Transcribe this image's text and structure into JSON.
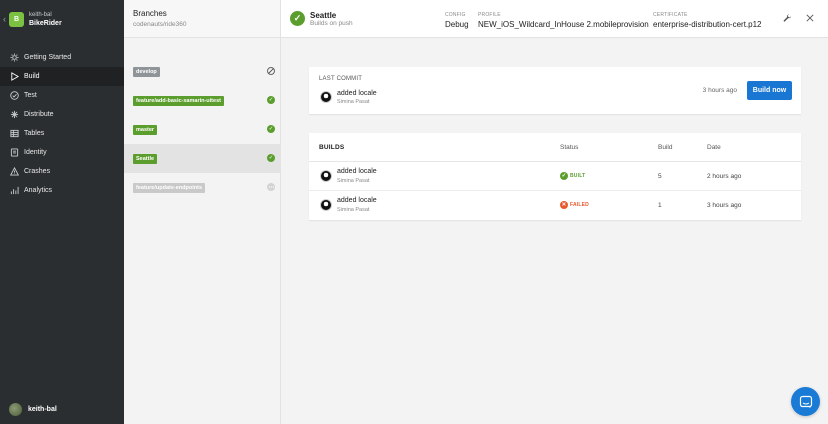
{
  "app": {
    "owner": "keith-bal",
    "name": "BikeRider",
    "logo_letter": "B",
    "logo_color": "#7cc142"
  },
  "sidebar": {
    "items": [
      {
        "label": "Getting Started",
        "icon": "gear-icon",
        "active": false
      },
      {
        "label": "Build",
        "icon": "play-icon",
        "active": true
      },
      {
        "label": "Test",
        "icon": "check-circle-icon",
        "active": false
      },
      {
        "label": "Distribute",
        "icon": "distribute-icon",
        "active": false
      },
      {
        "label": "Tables",
        "icon": "tables-icon",
        "active": false
      },
      {
        "label": "Identity",
        "icon": "id-card-icon",
        "active": false
      },
      {
        "label": "Crashes",
        "icon": "warning-icon",
        "active": false
      },
      {
        "label": "Analytics",
        "icon": "bar-chart-icon",
        "active": false
      }
    ],
    "user": {
      "name": "keith-bal"
    }
  },
  "branches": {
    "title": "Branches",
    "repo": "codenauts/ride360",
    "items": [
      {
        "name": "develop",
        "tag_color": "#8f9498",
        "status": "not-configured"
      },
      {
        "name": "feature/add-basic-xamarin-uitest",
        "tag_color": "#5c9e2e",
        "status": "built"
      },
      {
        "name": "master",
        "tag_color": "#5c9e2e",
        "status": "built"
      },
      {
        "name": "Seattle",
        "tag_color": "#5c9e2e",
        "status": "built",
        "selected": true
      },
      {
        "name": "feature/update-endpoints",
        "tag_color": "#c9c9c9",
        "status": "pending"
      }
    ]
  },
  "topbar": {
    "branch": "Seattle",
    "subtitle": "Builds on push",
    "config_label": "CONFIG",
    "config_value": "Debug",
    "profile_label": "PROFILE",
    "profile_value": "NEW_iOS_Wildcard_InHouse 2.mobileprovision",
    "certificate_label": "CERTIFICATE",
    "certificate_value": "enterprise-distribution-cert.p12"
  },
  "last_commit": {
    "label": "LAST COMMIT",
    "message": "added locale",
    "author": "Simina Pasat",
    "time": "3 hours ago",
    "build_button": "Build now"
  },
  "builds": {
    "headers": {
      "title": "BUILDS",
      "status": "Status",
      "build": "Build",
      "date": "Date"
    },
    "rows": [
      {
        "message": "added locale",
        "author": "Simina Pasat",
        "status": "BUILT",
        "status_color": "#5c9e2e",
        "build": "5",
        "date": "2 hours ago"
      },
      {
        "message": "added locale",
        "author": "Simina Pasat",
        "status": "FAILED",
        "status_color": "#e8582d",
        "build": "1",
        "date": "3 hours ago"
      }
    ]
  },
  "colors": {
    "accent": "#1976d2",
    "success": "#5c9e2e",
    "failure": "#e8582d",
    "sidebar_bg": "#2b2e30"
  }
}
